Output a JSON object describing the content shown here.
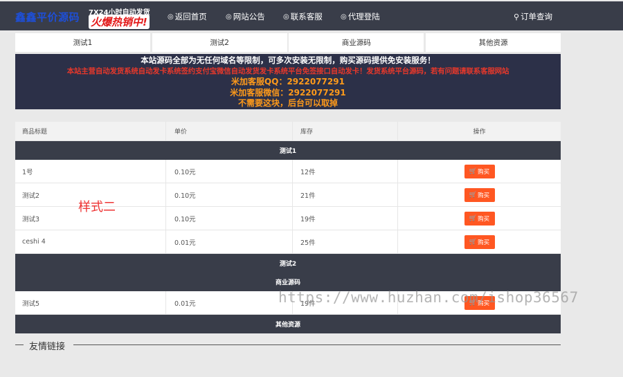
{
  "header": {
    "logo": "鑫鑫平价源码",
    "promo_top": "7X24小时自动发货",
    "promo_main": "火爆热销中!",
    "nav": [
      {
        "icon": "◎",
        "label": "返回首页"
      },
      {
        "icon": "◎",
        "label": "网站公告"
      },
      {
        "icon": "◎",
        "label": "联系客服"
      },
      {
        "icon": "◎",
        "label": "代理登陆"
      }
    ],
    "search": {
      "icon": "⚲",
      "label": "订单查询"
    }
  },
  "tabs": [
    "测试1",
    "测试2",
    "商业源码",
    "其他资源"
  ],
  "notice": {
    "line1": "本站源码全部为无任何域名等限制，可多次安装无限制，购买源码提供免安装服务！",
    "line2": "本站主营自动发货系统自动发卡系统签约支付宝微信自动发货发卡系统平台免签接口自动发卡！发货系统平台源码，若有问题请联系客服网站",
    "line3": "米加客服QQ：2922077291",
    "line4": "米加客服微信：2922077291",
    "line5": "不需要这块，后台可以取掉"
  },
  "table": {
    "headers": [
      "商品标题",
      "单价",
      "库存",
      "操作"
    ],
    "buy_icon": "🛒",
    "buy_label": "购买",
    "groups": [
      {
        "name": "测试1",
        "items": [
          {
            "title": "1号",
            "price": "0.10元",
            "stock": "12件"
          },
          {
            "title": "测试2",
            "price": "0.10元",
            "stock": "21件"
          },
          {
            "title": "测试3",
            "price": "0.10元",
            "stock": "19件"
          },
          {
            "title": "ceshi 4",
            "price": "0.01元",
            "stock": "25件"
          }
        ]
      },
      {
        "name": "测试2",
        "items": []
      },
      {
        "name": "商业源码",
        "items": [
          {
            "title": "测试5",
            "price": "0.01元",
            "stock": "19件"
          }
        ]
      },
      {
        "name": "其他资源",
        "items": []
      }
    ]
  },
  "overlay_label": "样式二",
  "watermark": "https://www.huzhan.com/ishop36567",
  "friend_links": "友情链接",
  "colors": {
    "header_bg": "#393d49",
    "buy_button": "#ff5722",
    "notice_bg": "#2c3048"
  }
}
